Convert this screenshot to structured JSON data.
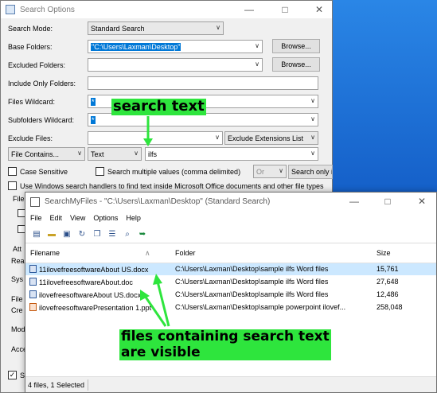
{
  "search_options": {
    "title": "Search Options",
    "labels": {
      "search_mode": "Search Mode:",
      "base_folders": "Base Folders:",
      "excluded_folders": "Excluded Folders:",
      "include_only": "Include Only Folders:",
      "files_wildcard": "Files Wildcard:",
      "subfolders_wildcard": "Subfolders Wildcard:",
      "exclude_files": "Exclude Files:"
    },
    "values": {
      "search_mode": "Standard Search",
      "base_folders": "\"C:\\Users\\Laxman\\Desktop\"",
      "files_wildcard": "*",
      "subfolders_wildcard": "*",
      "exclude_ext": "Exclude Extensions List",
      "contains_mode": "File Contains...",
      "contains_type": "Text",
      "contains_text": "ilfs",
      "or_value": "Or"
    },
    "buttons": {
      "browse": "Browse...",
      "search_only": "Search only i"
    },
    "checks": {
      "case_sensitive": "Case Sensitive",
      "multiple": "Search multiple values (comma delimited)",
      "windows_handlers": "Use Windows search handlers to find text inside Microsoft Office documents and other file types"
    },
    "partial": {
      "file1": "File",
      "attr": "Att",
      "rea": "Rea",
      "sys": "Sys",
      "file2": "File",
      "cre": "Cre",
      "mod": "Mod",
      "acc": "Acce",
      "st": "St"
    }
  },
  "annotations": {
    "search_text": "search text",
    "files_line1": "files containing search text",
    "files_line2": "are visible"
  },
  "results_window": {
    "title": "SearchMyFiles -  \"C:\\Users\\Laxman\\Desktop\"  (Standard Search)",
    "menu": [
      "File",
      "Edit",
      "View",
      "Options",
      "Help"
    ],
    "columns": [
      "Filename",
      "Folder",
      "Size"
    ],
    "rows": [
      {
        "filename": "11ilovefreesoftwareAbout US.docx",
        "folder": "C:\\Users\\Laxman\\Desktop\\sample ilfs Word files",
        "size": "15,761",
        "type": "doc",
        "selected": true
      },
      {
        "filename": "11ilovefreesoftwareAbout.doc",
        "folder": "C:\\Users\\Laxman\\Desktop\\sample ilfs Word files",
        "size": "27,648",
        "type": "doc",
        "selected": false
      },
      {
        "filename": "ilovefreesoftwareAbout US.docx",
        "folder": "C:\\Users\\Laxman\\Desktop\\sample ilfs Word files",
        "size": "12,486",
        "type": "doc",
        "selected": false
      },
      {
        "filename": "ilovefreesoftwarePresentation 1.ppt",
        "folder": "C:\\Users\\Laxman\\Desktop\\sample powerpoint ilovef...",
        "size": "258,048",
        "type": "ppt",
        "selected": false
      }
    ],
    "status": {
      "count": "4 files, 1 Selected"
    }
  }
}
